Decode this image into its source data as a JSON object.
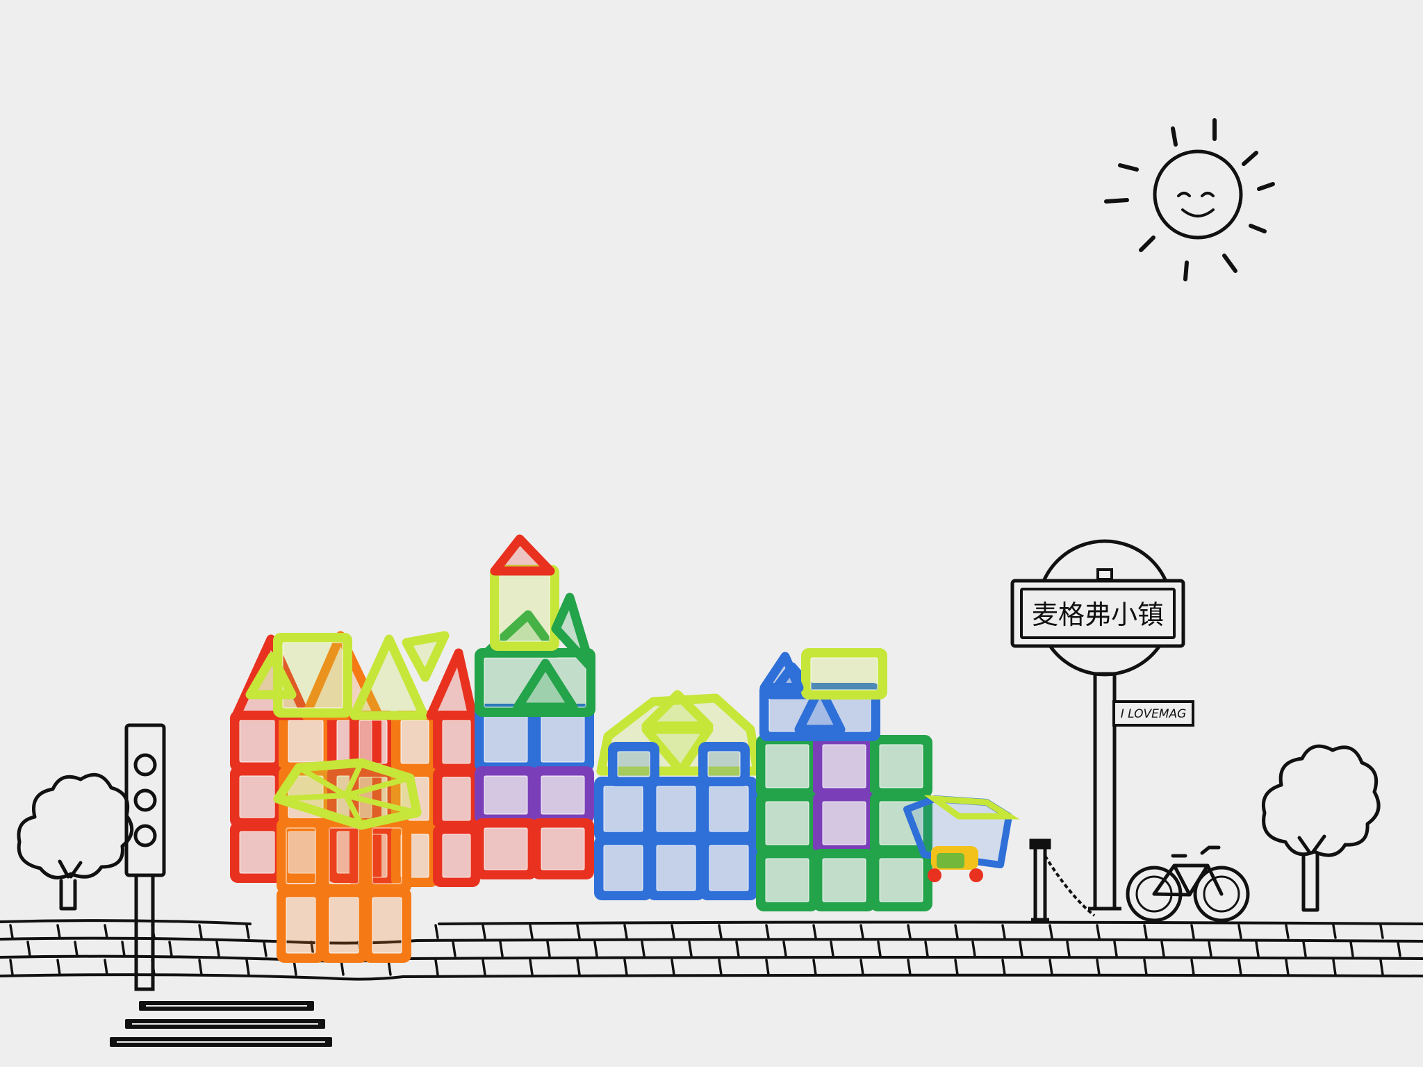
{
  "town_sign": {
    "name": "麦格弗小镇"
  },
  "plate": {
    "text": "I LOVEMAG"
  },
  "colors": {
    "background": "#efeeef",
    "ink": "#111111",
    "tile_red": "#e8321f",
    "tile_orange": "#f57a16",
    "tile_lime": "#c6e63a",
    "tile_green": "#23a34a",
    "tile_blue": "#2f6fd8",
    "tile_purple": "#7a3fb8"
  },
  "icons": [
    "sun-icon",
    "traffic-light-icon",
    "tree-icon",
    "bicycle-icon",
    "crosswalk-icon",
    "bollard-chain-icon"
  ]
}
